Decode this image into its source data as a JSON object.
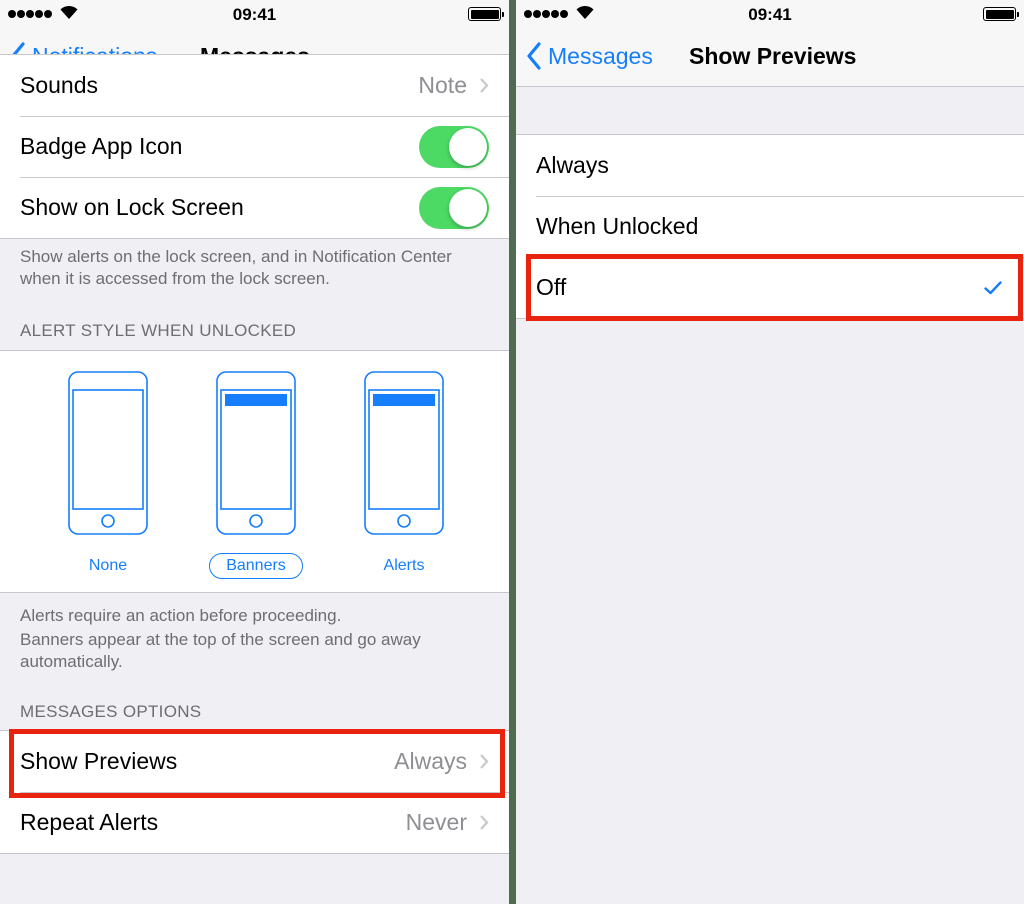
{
  "status_bar": {
    "time": "09:41"
  },
  "left": {
    "nav": {
      "back_label": "Notifications",
      "title": "Messages"
    },
    "partial_row": {
      "label": "Sounds",
      "value": "Note"
    },
    "toggles": [
      {
        "label": "Badge App Icon",
        "on": true
      },
      {
        "label": "Show on Lock Screen",
        "on": true
      }
    ],
    "lock_screen_footer": "Show alerts on the lock screen, and in Notification Center when it is accessed from the lock screen.",
    "alert_style_header": "ALERT STYLE WHEN UNLOCKED",
    "alert_styles": [
      {
        "label": "None",
        "selected": false
      },
      {
        "label": "Banners",
        "selected": true
      },
      {
        "label": "Alerts",
        "selected": false
      }
    ],
    "alert_footer_1": "Alerts require an action before proceeding.",
    "alert_footer_2": "Banners appear at the top of the screen and go away automatically.",
    "options_header": "MESSAGES OPTIONS",
    "options": [
      {
        "label": "Show Previews",
        "value": "Always"
      },
      {
        "label": "Repeat Alerts",
        "value": "Never"
      }
    ]
  },
  "right": {
    "nav": {
      "back_label": "Messages",
      "title": "Show Previews"
    },
    "choices": [
      {
        "label": "Always",
        "checked": false
      },
      {
        "label": "When Unlocked",
        "checked": false
      },
      {
        "label": "Off",
        "checked": true
      }
    ]
  },
  "colors": {
    "accent": "#157efb",
    "toggle_on": "#4cd964",
    "highlight": "#e8230e",
    "background": "#efeff4"
  }
}
